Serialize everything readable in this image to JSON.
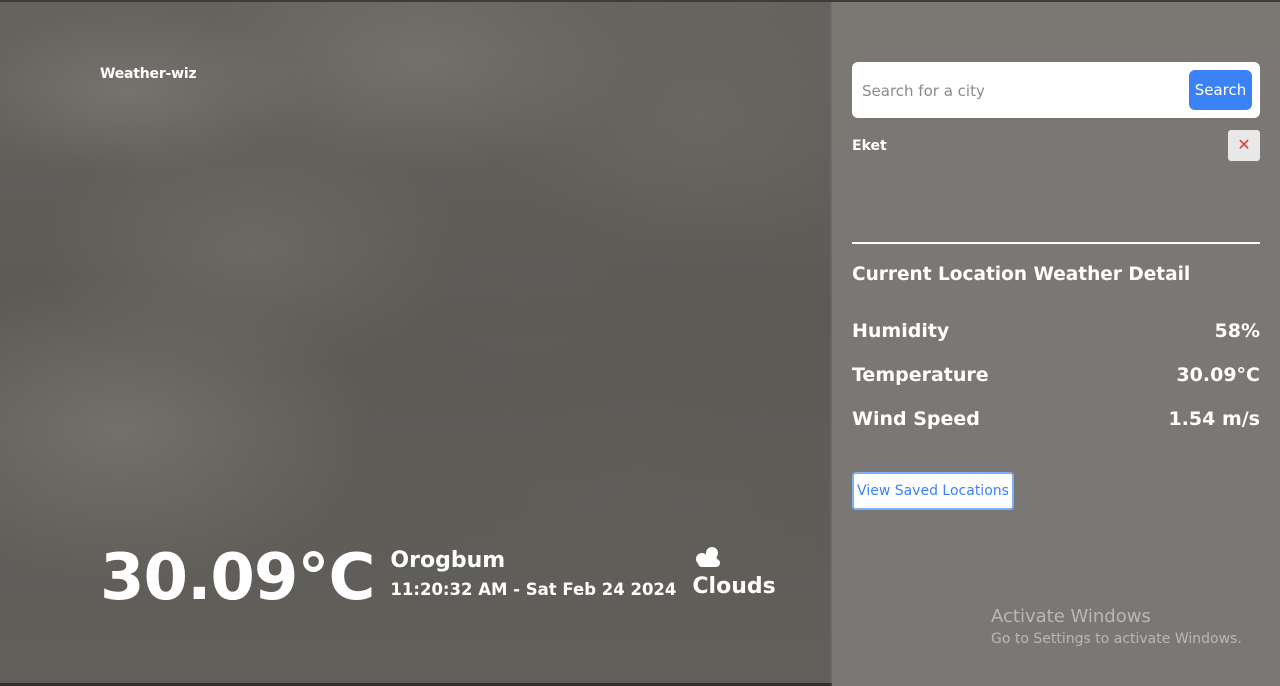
{
  "app": {
    "brand": "Weather-wiz"
  },
  "current": {
    "temperature": "30.09°C",
    "city": "Orogbum",
    "datetime": "11:20:32 AM - Sat Feb 24 2024",
    "condition": "Clouds",
    "condition_icon": "cloud-icon"
  },
  "search": {
    "placeholder": "Search for a city",
    "value": "",
    "button_label": "Search"
  },
  "recent": [
    {
      "name": "Eket",
      "remove_label": "✕"
    }
  ],
  "details": {
    "title": "Current Location Weather Detail",
    "rows": [
      {
        "label": "Humidity",
        "value": "58%"
      },
      {
        "label": "Temperature",
        "value": "30.09°C"
      },
      {
        "label": "Wind Speed",
        "value": "1.54 m/s"
      }
    ]
  },
  "saved_button_label": "View Saved Locations",
  "watermark": {
    "title": "Activate Windows",
    "subtitle": "Go to Settings to activate Windows."
  },
  "colors": {
    "accent": "#3b82f6",
    "remove": "#e53935",
    "panel": "#7d7a76"
  }
}
